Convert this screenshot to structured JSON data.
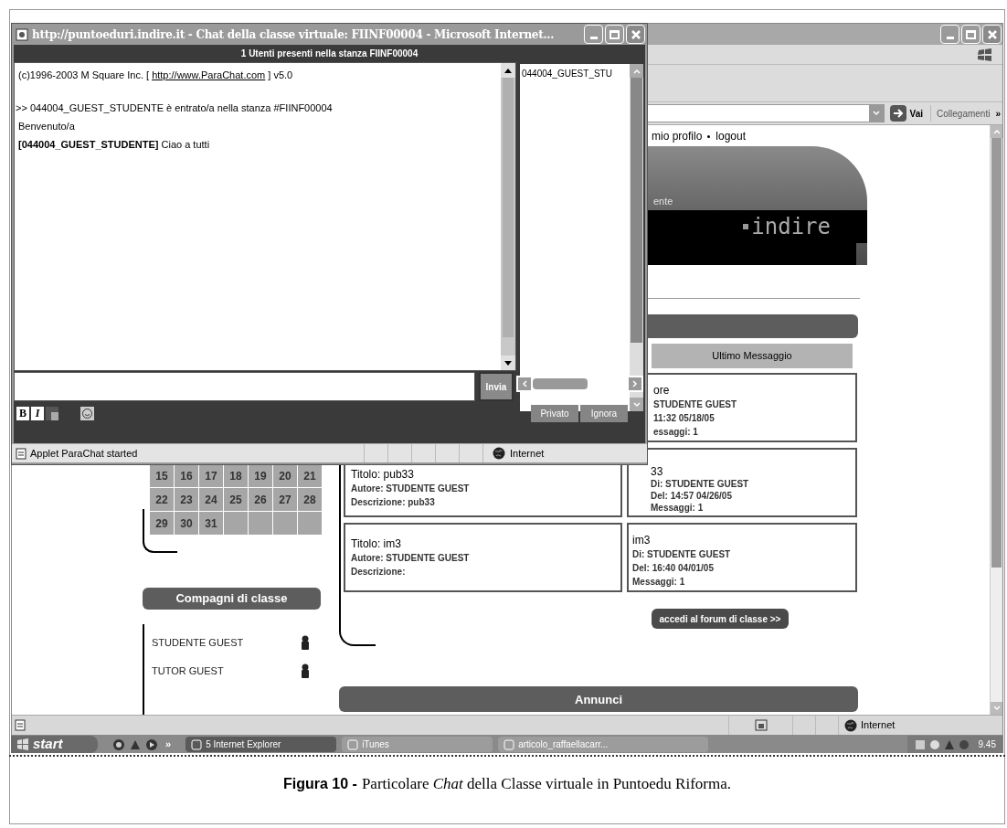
{
  "browser": {
    "go": "Vai",
    "links": "Collegamenti",
    "more": "»",
    "status_zone": "Internet"
  },
  "page": {
    "top_links": [
      "mio profilo",
      "logout"
    ],
    "banner": {
      "partial_label": "ente",
      "logo": "indire"
    },
    "calendar": {
      "weeks": [
        [
          "15",
          "16",
          "17",
          "18",
          "19",
          "20",
          "21"
        ],
        [
          "22",
          "23",
          "24",
          "25",
          "26",
          "27",
          "28"
        ],
        [
          "29",
          "30",
          "31"
        ]
      ]
    },
    "classmates": {
      "title": "Compagni di classe",
      "people": [
        {
          "name": "STUDENTE GUEST"
        },
        {
          "name": "TUTOR GUEST"
        }
      ]
    },
    "forum_header": "Ultimo Messaggio",
    "topics": [
      {
        "lines": [
          "Titolo: pub33",
          "Autore: STUDENTE GUEST",
          "Descrizione: pub33"
        ]
      },
      {
        "lines": [
          "Titolo: im3",
          "Autore: STUDENTE GUEST",
          "Descrizione:"
        ]
      }
    ],
    "latest": [
      {
        "lines": [
          "ore",
          "STUDENTE GUEST",
          "11:32 05/18/05",
          "essaggi: 1"
        ]
      },
      {
        "lines": [
          "33",
          "Di: STUDENTE GUEST",
          "Del: 14:57 04/26/05",
          "Messaggi: 1"
        ]
      },
      {
        "lines": [
          "im3",
          "Di: STUDENTE GUEST",
          "Del: 16:40 04/01/05",
          "Messaggi: 1"
        ]
      }
    ],
    "forum_button": "accedi al forum di classe >>",
    "announcements": "Annunci"
  },
  "popup": {
    "title": "http://puntoeduri.indire.it - Chat della classe virtuale: FIINF00004 - Microsoft Internet...",
    "room_header": "1 Utenti presenti nella stanza FIINF00004",
    "messages": [
      {
        "kind": "credit",
        "before": "(c)1996-2003 M Square Inc. [ ",
        "link": "http://www.ParaChat.com",
        "after": " ] v5.0"
      },
      {
        "kind": "event",
        "text": ">> 044004_GUEST_STUDENTE è entrato/a nella stanza #FIINF00004"
      },
      {
        "kind": "text",
        "text": "Benvenuto/a"
      },
      {
        "kind": "text",
        "text": "**[044004_GUEST_STUDENTE]** Ciao a tutti"
      }
    ],
    "users": [
      {
        "name": "044004_GUEST_STU"
      }
    ],
    "send_button": {
      "label": "Invia",
      "disabled": true
    },
    "format_buttons": [
      "B",
      "I"
    ],
    "action_buttons": [
      {
        "label": "Privato",
        "disabled": true
      },
      {
        "label": "Ignora",
        "disabled": true
      }
    ],
    "status": "Applet ParaChat started",
    "zone": "Internet"
  },
  "taskbar": {
    "start": "start",
    "more": "»",
    "tasks": [
      {
        "label": "5 Internet Explorer",
        "selected": true
      },
      {
        "label": "iTunes",
        "selected": false
      },
      {
        "label": "articolo_raffaellacarr...",
        "selected": false
      }
    ],
    "clock": "9.45"
  },
  "caption": {
    "label": "Figura 10 -",
    "text": "Particolare *Chat* della Classe virtuale in Puntoedu Riforma."
  }
}
